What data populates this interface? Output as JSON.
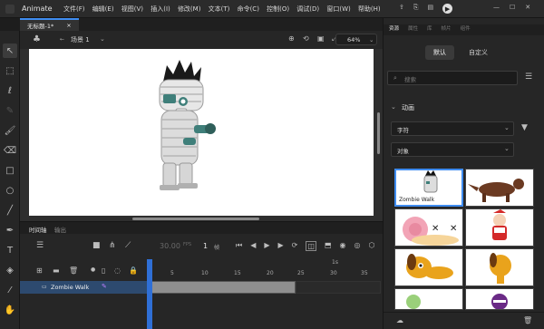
{
  "app": {
    "name": "Animate"
  },
  "menu": [
    "文件(F)",
    "编辑(E)",
    "视图(V)",
    "插入(I)",
    "修改(M)",
    "文本(T)",
    "命令(C)",
    "控制(O)",
    "调试(D)",
    "窗口(W)",
    "帮助(H)"
  ],
  "document": {
    "tab_title": "无标题-1*",
    "close": "×"
  },
  "scene": {
    "label": "场景 1",
    "zoom": "64%"
  },
  "timeline": {
    "tab": "时间轴",
    "tab2": "输出",
    "fps": "30.00",
    "fps_unit": "FPS",
    "frame": "1",
    "frame_unit": "帧",
    "ruler": [
      "1s",
      "5",
      "10",
      "15",
      "20",
      "25",
      "30",
      "35"
    ],
    "layer": "Zombie Walk"
  },
  "assets": {
    "panel_tabs": [
      "资源",
      "属性",
      "库",
      "帧片",
      "组件"
    ],
    "segment_default": "默认",
    "segment_custom": "自定义",
    "search_placeholder": "搜索",
    "category": "动画",
    "filter_character": "字符",
    "filter_object": "对象",
    "thumbs": [
      {
        "label": "Zombie Walk",
        "selected": true
      },
      {
        "label": "",
        "selected": false
      },
      {
        "label": "",
        "selected": false
      },
      {
        "label": "",
        "selected": false
      },
      {
        "label": "",
        "selected": false
      },
      {
        "label": "",
        "selected": false
      },
      {
        "label": "",
        "selected": false
      },
      {
        "label": "",
        "selected": false
      }
    ]
  },
  "colors": {
    "accent": "#3f8cf0",
    "playhead": "#2f6fd6",
    "layer_highlight": "#2d4a6f"
  }
}
